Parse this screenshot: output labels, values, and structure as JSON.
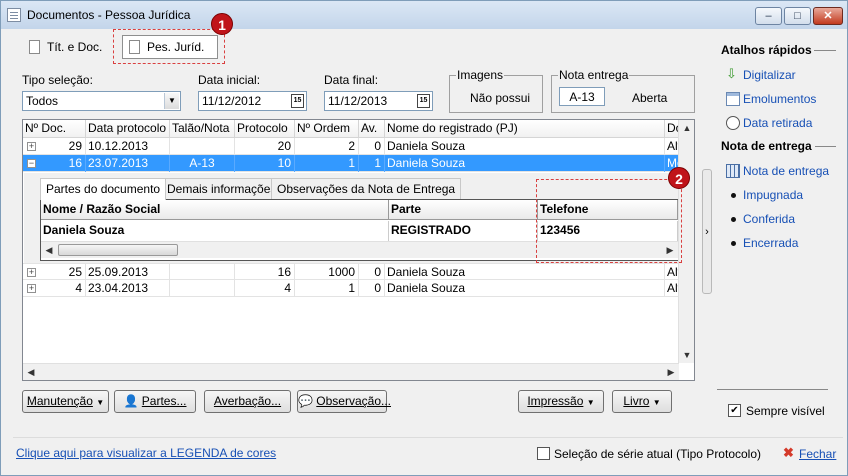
{
  "window": {
    "title": "Documentos - Pessoa Jurídica",
    "controls": {
      "minimize": "–",
      "maximize": "□",
      "close": "✕"
    }
  },
  "tabs": [
    {
      "label": "Tít. e Doc."
    },
    {
      "label": "Pes. Juríd."
    }
  ],
  "filters": {
    "tipo_selecao_label": "Tipo seleção:",
    "tipo_selecao_value": "Todos",
    "data_inicial_label": "Data inicial:",
    "data_inicial_value": "11/12/2012",
    "data_final_label": "Data final:",
    "data_final_value": "11/12/2013",
    "calendar_glyph": "15"
  },
  "imagens": {
    "title": "Imagens",
    "value": "Não possui"
  },
  "nota_entrega": {
    "title": "Nota entrega",
    "numero": "A-13",
    "status": "Aberta"
  },
  "grid": {
    "columns": [
      "Nº Doc.",
      "Data protocolo",
      "Talão/Nota",
      "Protocolo",
      "Nº Ordem",
      "Av.",
      "Nome do registrado (PJ)",
      "Do"
    ],
    "rows": [
      {
        "expander": "+",
        "doc": "29",
        "data": "10.12.2013",
        "talao": "",
        "protocolo": "20",
        "ordem": "2",
        "av": "0",
        "nome": "Daniela Souza",
        "extra": "Alt"
      },
      {
        "expander": "−",
        "doc": "16",
        "data": "23.07.2013",
        "talao": "A-13",
        "protocolo": "10",
        "ordem": "1",
        "av": "1",
        "nome": "Daniela Souza",
        "extra": "Mo"
      },
      {
        "expander": "+",
        "doc": "25",
        "data": "25.09.2013",
        "talao": "",
        "protocolo": "16",
        "ordem": "1000",
        "av": "0",
        "nome": "Daniela Souza",
        "extra": "Alt"
      },
      {
        "expander": "+",
        "doc": "4",
        "data": "23.04.2013",
        "talao": "",
        "protocolo": "4",
        "ordem": "1",
        "av": "0",
        "nome": "Daniela Souza",
        "extra": "Alt"
      }
    ]
  },
  "detail": {
    "tabs": [
      "Partes do documento",
      "Demais informações",
      "Observações da Nota de Entrega"
    ],
    "columns": [
      "Nome / Razão Social",
      "Parte",
      "Telefone"
    ],
    "row": {
      "nome": "Daniela Souza",
      "parte": "REGISTRADO",
      "telefone": "123456"
    }
  },
  "buttons": {
    "manutencao": "Manutenção",
    "partes": "Partes...",
    "averbacao": "Averbação...",
    "observacao": "Observação...",
    "impressao": "Impressão",
    "livro": "Livro"
  },
  "sidebar": {
    "atalhos_title": "Atalhos rápidos",
    "atalhos": [
      {
        "label": "Digitalizar",
        "icon": "download-arrow-icon"
      },
      {
        "label": "Emolumentos",
        "icon": "window-icon"
      },
      {
        "label": "Data retirada",
        "icon": "clock-icon"
      }
    ],
    "nota_title": "Nota de entrega",
    "nota_items": [
      {
        "label": "Nota de entrega",
        "icon": "grid-icon"
      },
      {
        "label": "Impugnada"
      },
      {
        "label": "Conferida"
      },
      {
        "label": "Encerrada"
      }
    ],
    "sempre_visivel": "Sempre visível",
    "collapse_arrow": "›"
  },
  "footer": {
    "legend_link": "Clique aqui para visualizar a LEGENDA de cores",
    "serie_checkbox": "Seleção de série atual (Tipo Protocolo)",
    "fechar": "Fechar"
  },
  "annotations": {
    "badge1": "1",
    "badge2": "2"
  },
  "colors": {
    "selection": "#3399ff",
    "link": "#1750b5",
    "badge": "#c0141a"
  }
}
